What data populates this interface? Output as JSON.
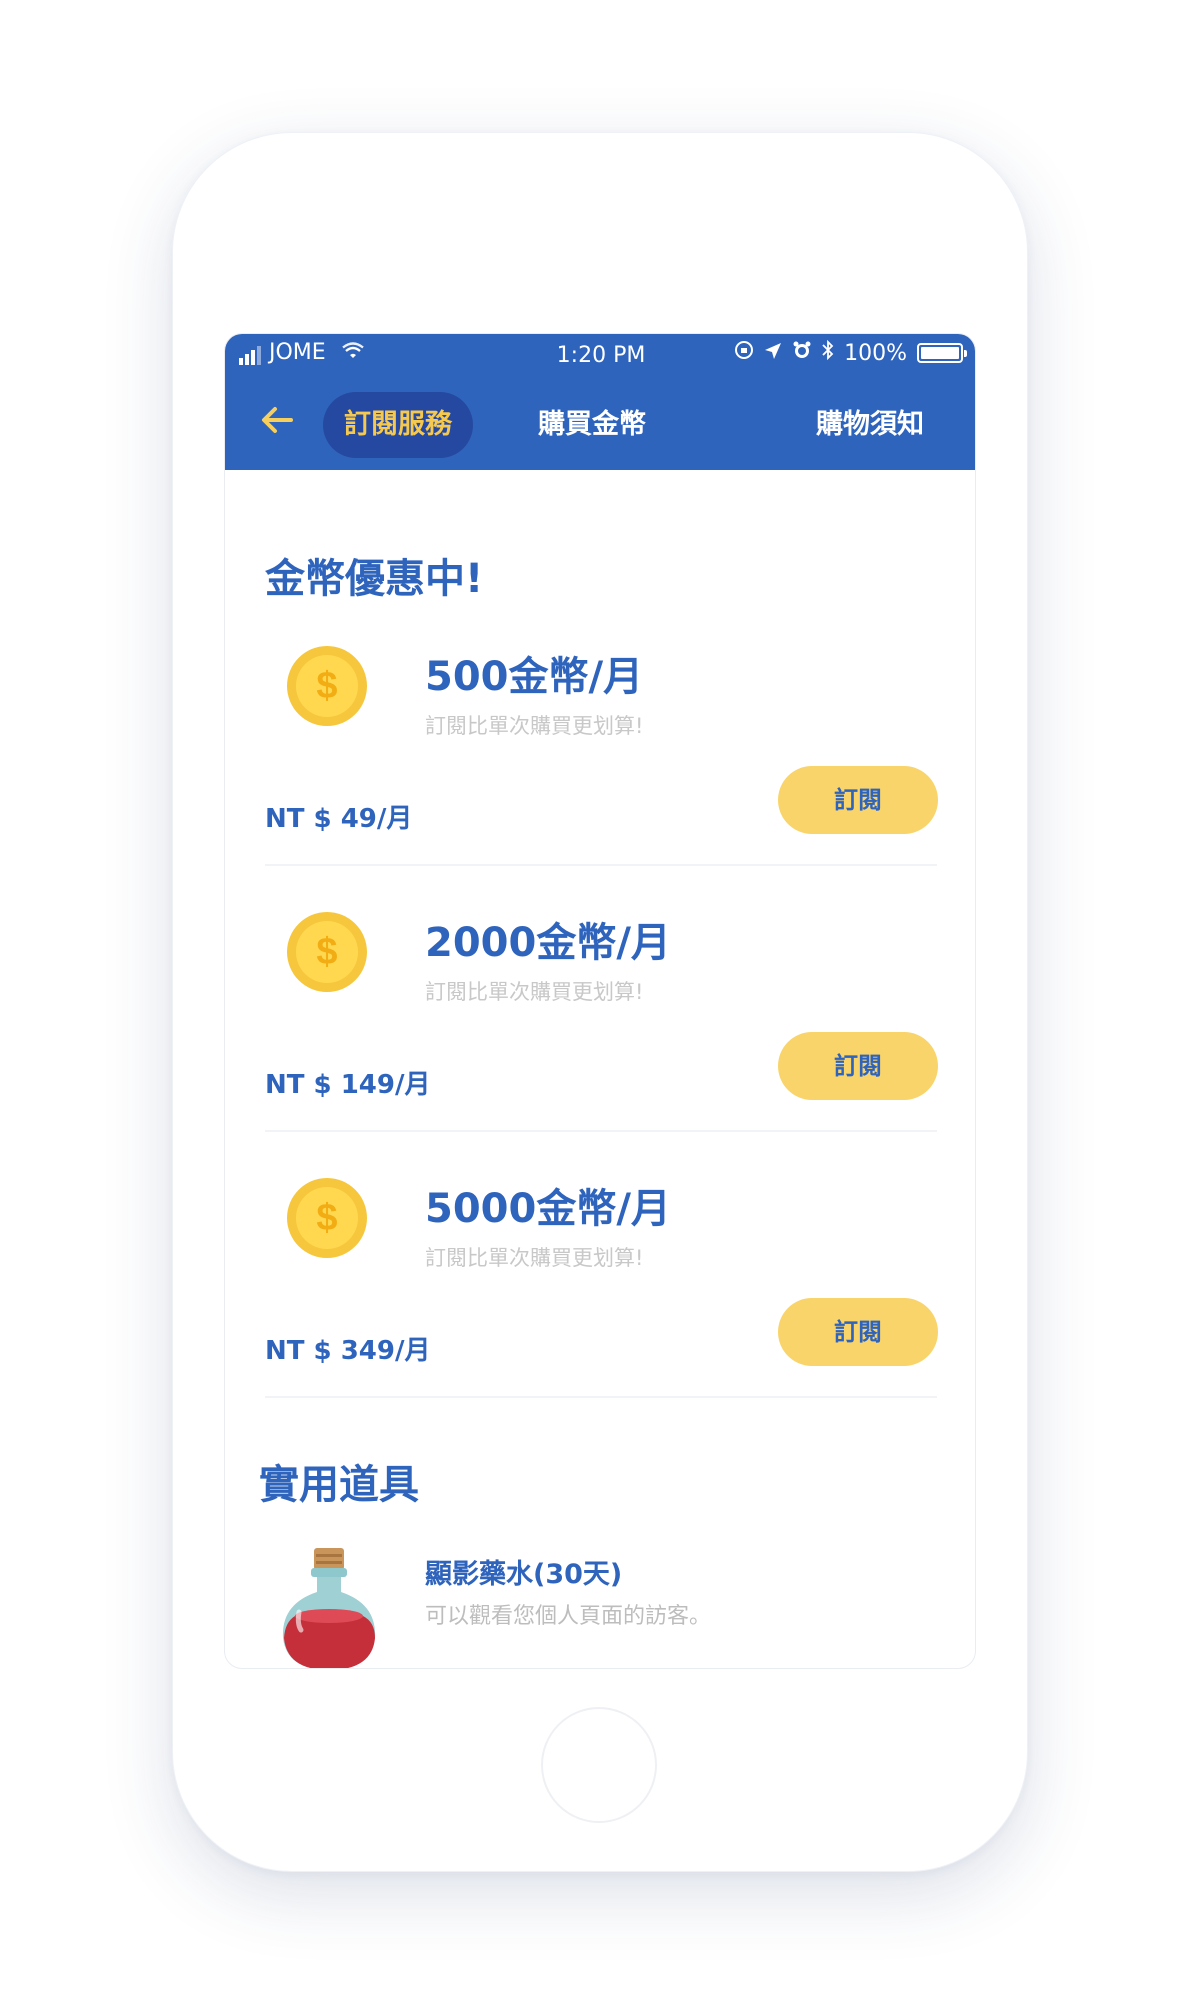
{
  "status_bar": {
    "carrier": "JOME",
    "time": "1:20 PM",
    "battery": "100%"
  },
  "nav": {
    "tabs": [
      {
        "label": "訂閱服務",
        "active": true
      },
      {
        "label": "購買金幣",
        "active": false
      },
      {
        "label": "購物須知",
        "active": false
      }
    ]
  },
  "colors": {
    "primary": "#2f64bd",
    "accent": "#f5c84f",
    "button": "#f9d46b"
  },
  "coin_section": {
    "title": "金幣優惠中!",
    "plans": [
      {
        "title": "500金幣/月",
        "desc": "訂閱比單次購買更划算!",
        "price": "NT $ 49/月",
        "button": "訂閱"
      },
      {
        "title": "2000金幣/月",
        "desc": "訂閱比單次購買更划算!",
        "price": "NT $ 149/月",
        "button": "訂閱"
      },
      {
        "title": "5000金幣/月",
        "desc": "訂閱比單次購買更划算!",
        "price": "NT $ 349/月",
        "button": "訂閱"
      }
    ]
  },
  "tools_section": {
    "title": "實用道具",
    "items": [
      {
        "title": "顯影藥水(30天)",
        "desc": "可以觀看您個人頁面的訪客。",
        "icon": "potion-icon"
      }
    ]
  }
}
